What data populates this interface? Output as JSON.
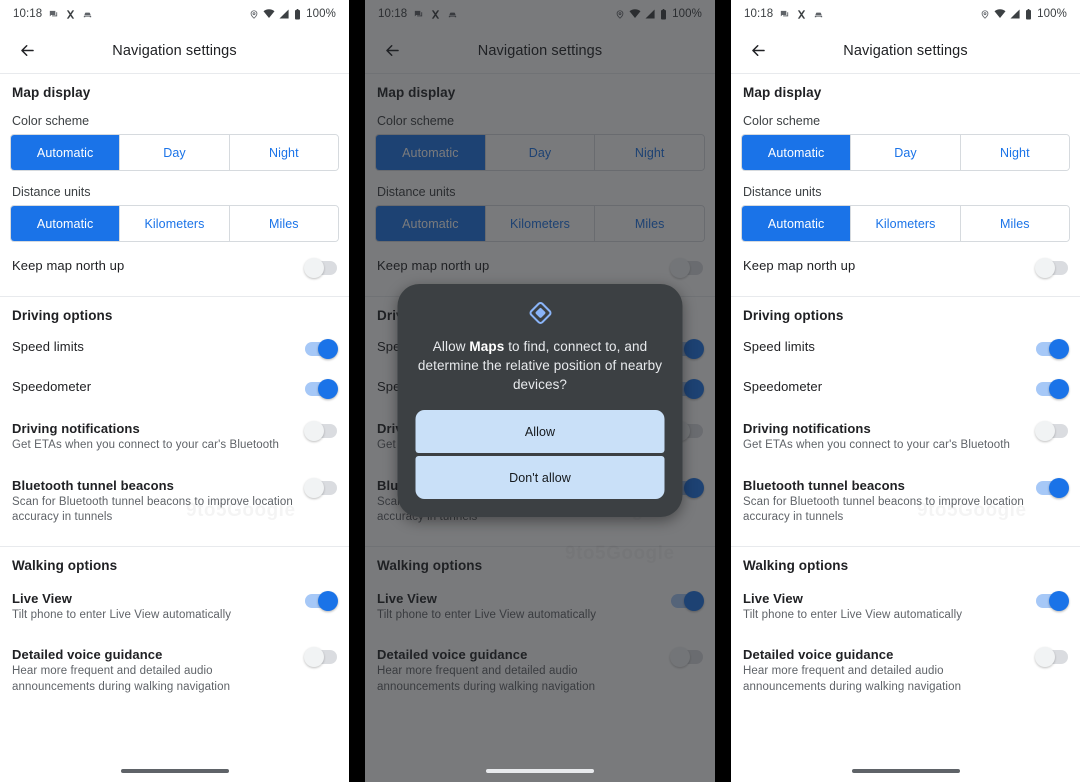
{
  "status_bar": {
    "time": "10:18",
    "battery_pct": "100%",
    "left_icons": [
      "sms-icon",
      "x-icon",
      "android-auto-icon"
    ],
    "right_icons": [
      "location-pin-icon",
      "wifi-icon",
      "cell-signal-icon",
      "battery-icon"
    ]
  },
  "app_bar": {
    "back_label": "back-arrow",
    "title": "Navigation settings"
  },
  "sections": {
    "map_display": "Map display",
    "driving_options": "Driving options",
    "walking_options": "Walking options"
  },
  "color_scheme": {
    "label": "Color scheme",
    "options": [
      "Automatic",
      "Day",
      "Night"
    ],
    "selected": "Automatic"
  },
  "distance_units": {
    "label": "Distance units",
    "options": [
      "Automatic",
      "Kilometers",
      "Miles"
    ],
    "selected": "Automatic"
  },
  "rows": {
    "keep_north_up": {
      "title": "Keep map north up",
      "sub": ""
    },
    "speed_limits": {
      "title": "Speed limits",
      "sub": ""
    },
    "speedometer": {
      "title": "Speedometer",
      "sub": ""
    },
    "driving_notifications": {
      "title": "Driving notifications",
      "sub": "Get ETAs when you connect to your car's Bluetooth"
    },
    "bluetooth_beacons": {
      "title": "Bluetooth tunnel beacons",
      "sub": "Scan for Bluetooth tunnel beacons to improve location accuracy in tunnels"
    },
    "live_view": {
      "title": "Live View",
      "sub": "Tilt phone to enter Live View automatically"
    },
    "detailed_voice": {
      "title": "Detailed voice guidance",
      "sub": "Hear more frequent and detailed audio announcements during walking navigation"
    }
  },
  "toggle_states": {
    "panel1": {
      "keep_north_up": "off",
      "speed_limits": "on",
      "speedometer": "on",
      "driving_notifications": "off",
      "bluetooth_beacons": "off",
      "live_view": "on",
      "detailed_voice": "off"
    },
    "panel2": {
      "keep_north_up": "off",
      "speed_limits": "on",
      "speedometer": "on",
      "driving_notifications": "off",
      "bluetooth_beacons": "on",
      "live_view": "on",
      "detailed_voice": "off"
    },
    "panel3": {
      "keep_north_up": "off",
      "speed_limits": "on",
      "speedometer": "on",
      "driving_notifications": "off",
      "bluetooth_beacons": "on",
      "live_view": "on",
      "detailed_voice": "off"
    }
  },
  "dialog": {
    "icon": "nearby-devices-diamond-icon",
    "message_prefix": "Allow ",
    "message_app": "Maps",
    "message_suffix": " to find, connect to, and determine the relative position of nearby devices?",
    "allow_label": "Allow",
    "deny_label": "Don't allow"
  },
  "watermark": {
    "text": "9to5Google"
  },
  "colors": {
    "accent_blue": "#1a73e8",
    "toggle_on_track": "#a6c8f7",
    "toggle_off_track": "#dadce0",
    "dialog_bg": "#3c4043",
    "dialog_button": "#c9e0f8",
    "text_primary": "#202124",
    "text_secondary": "#5f6368"
  }
}
